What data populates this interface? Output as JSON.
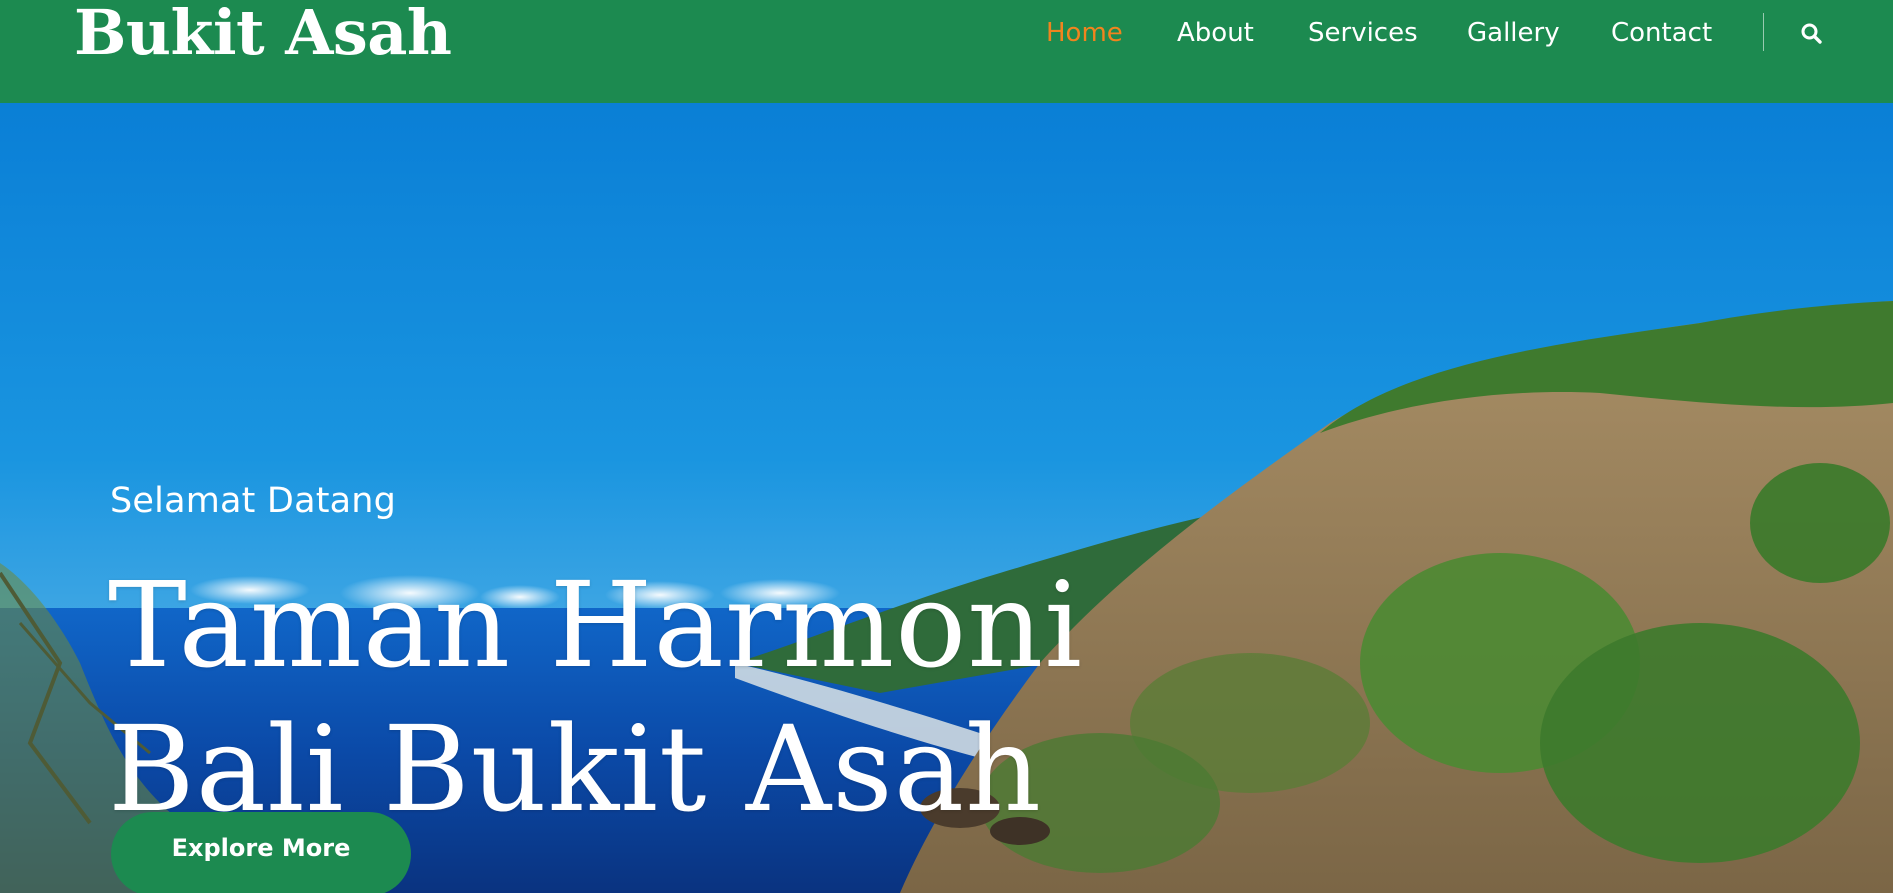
{
  "header": {
    "brand": "Bukit Asah",
    "nav": [
      "Home",
      "About",
      "Services",
      "Gallery",
      "Contact"
    ],
    "active": "Home",
    "search_icon": "search-icon"
  },
  "hero": {
    "welcome": "Selamat Datang",
    "title_line1": "Taman Harmoni",
    "title_line2": "Bali Bukit Asah",
    "cta_label": "Explore More"
  },
  "colors": {
    "header_bg": "#1c8a50",
    "active_nav": "#f0841e",
    "text": "#ffffff",
    "sky": "#0a78d0",
    "sea": "#0a3f9a"
  }
}
